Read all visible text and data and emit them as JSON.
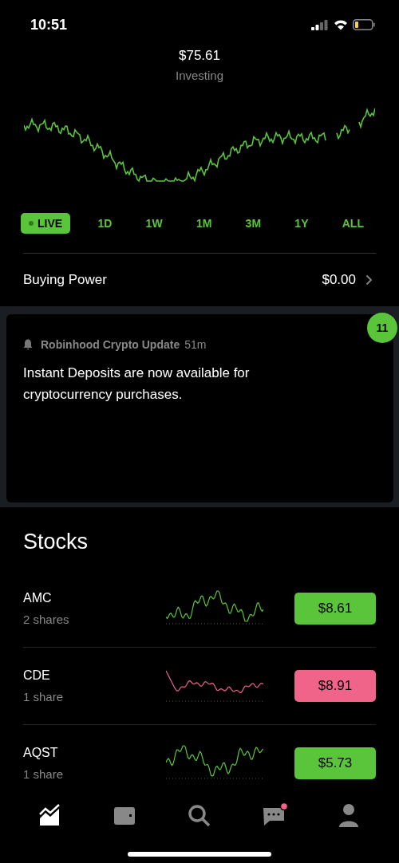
{
  "status_bar": {
    "time": "10:51"
  },
  "portfolio": {
    "value": "$75.61",
    "label": "Investing"
  },
  "ranges": [
    {
      "label": "LIVE",
      "selected": true
    },
    {
      "label": "1D",
      "selected": false
    },
    {
      "label": "1W",
      "selected": false
    },
    {
      "label": "1M",
      "selected": false
    },
    {
      "label": "3M",
      "selected": false
    },
    {
      "label": "1Y",
      "selected": false
    },
    {
      "label": "ALL",
      "selected": false
    }
  ],
  "buying_power": {
    "label": "Buying Power",
    "value": "$0.00"
  },
  "notification": {
    "badge": "11",
    "source": "Robinhood Crypto Update",
    "age": "51m",
    "message": "Instant Deposits are now available for cryptocurrency purchases."
  },
  "stocks": {
    "title": "Stocks",
    "items": [
      {
        "symbol": "AMC",
        "shares": "2 shares",
        "price": "$8.61",
        "color": "#5ac53b"
      },
      {
        "symbol": "CDE",
        "shares": "1 share",
        "price": "$8.91",
        "color": "#f0648a"
      },
      {
        "symbol": "AQST",
        "shares": "1 share",
        "price": "$5.73",
        "color": "#5ac53b"
      }
    ]
  },
  "tab_bar": [
    {
      "kind": "chart",
      "selected": true,
      "unread": false
    },
    {
      "kind": "wallet",
      "selected": false,
      "unread": false
    },
    {
      "kind": "search",
      "selected": false,
      "unread": false
    },
    {
      "kind": "chat",
      "selected": false,
      "unread": true
    },
    {
      "kind": "person",
      "selected": false,
      "unread": false
    }
  ]
}
